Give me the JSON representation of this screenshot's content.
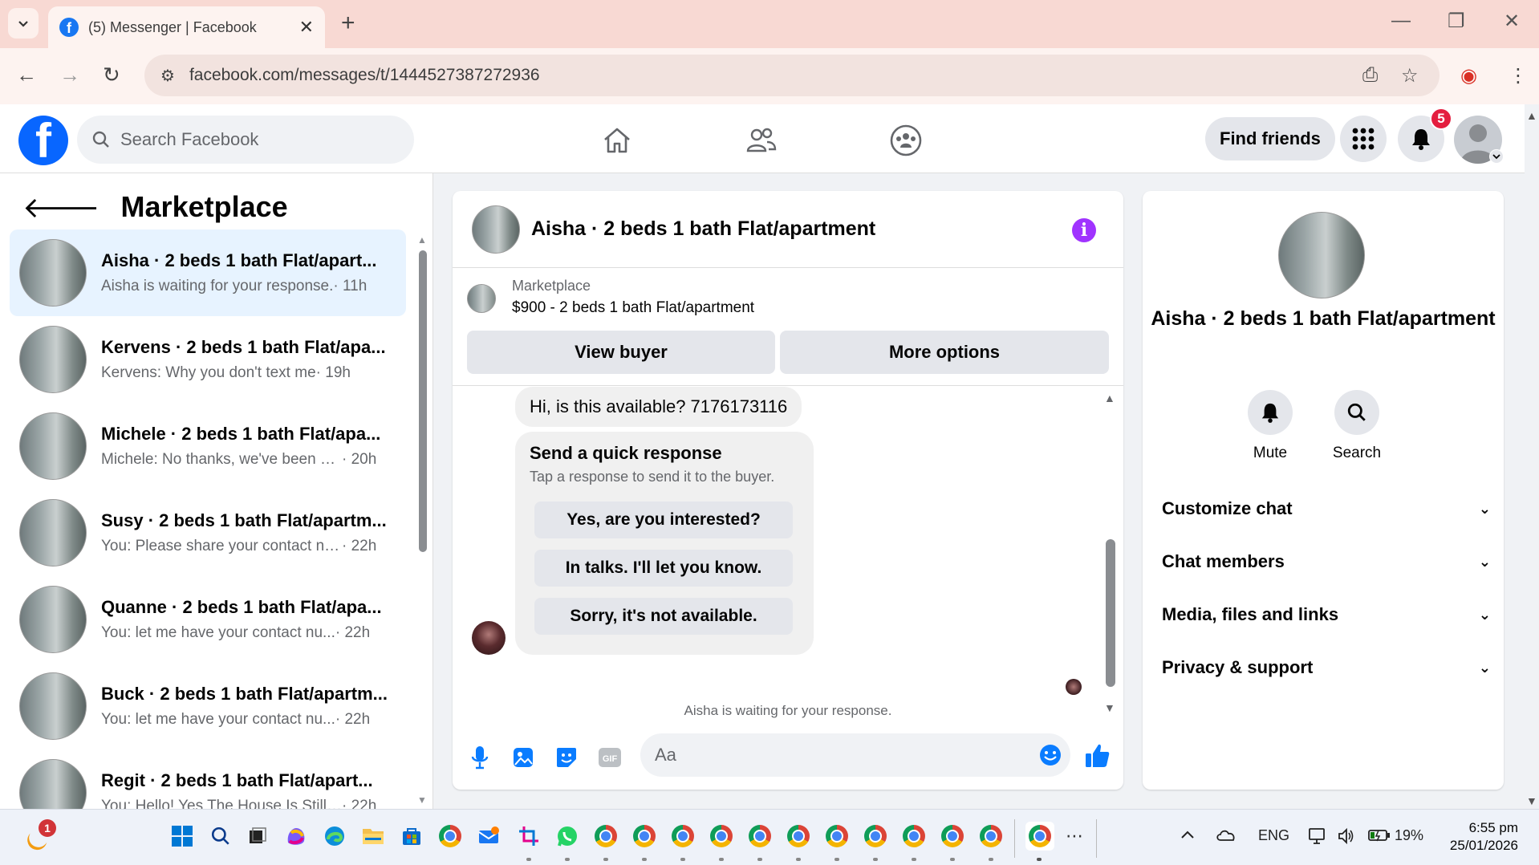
{
  "browser": {
    "tab_title": "(5) Messenger | Facebook",
    "url": "facebook.com/messages/t/1444527387272936"
  },
  "fb": {
    "search_placeholder": "Search Facebook",
    "find_friends": "Find friends",
    "notification_count": "5"
  },
  "left": {
    "title": "Marketplace",
    "conversations": [
      {
        "name": "Aisha · 2 beds 1 bath Flat/apart...",
        "preview": "Aisha is waiting for your response.",
        "time": "· 11h",
        "active": true
      },
      {
        "name": "Kervens · 2 beds 1 bath Flat/apa...",
        "preview": "Kervens: Why you don't text me",
        "time": "· 19h"
      },
      {
        "name": "Michele · 2 beds 1 bath Flat/apa...",
        "preview": "Michele: No thanks, we've been al...",
        "time": "· 20h"
      },
      {
        "name": "Susy · 2 beds 1 bath Flat/apartm...",
        "preview": "You: Please share your contact nu...",
        "time": "· 22h"
      },
      {
        "name": "Quanne · 2 beds 1 bath Flat/apa...",
        "preview": "You: let me have your contact nu...",
        "time": "· 22h"
      },
      {
        "name": "Buck · 2 beds 1 bath Flat/apartm...",
        "preview": "You: let me have your contact nu...",
        "time": "· 22h"
      },
      {
        "name": "Regit · 2 beds 1 bath Flat/apart...",
        "preview": "You: Hello! Yes The House Is Still A...",
        "time": "· 22h"
      }
    ]
  },
  "chat": {
    "title": "Aisha · 2 beds 1 bath Flat/apartment",
    "marketplace_label": "Marketplace",
    "listing": "$900 - 2 beds 1 bath Flat/apartment",
    "view_buyer": "View buyer",
    "more_options": "More options",
    "message": "Hi, is this available? 7176173116",
    "quick_title": "Send a quick response",
    "quick_sub": "Tap a response to send it to the buyer.",
    "quick_responses": [
      "Yes, are you interested?",
      "In talks. I'll let you know.",
      "Sorry, it's not available."
    ],
    "waiting": "Aisha is waiting for your response.",
    "composer_placeholder": "Aa",
    "gif_label": "GIF"
  },
  "right": {
    "name": "Aisha · 2 beds 1 bath Flat/apartment",
    "mute": "Mute",
    "search": "Search",
    "sections": [
      "Customize chat",
      "Chat members",
      "Media, files and links",
      "Privacy & support"
    ]
  },
  "taskbar": {
    "start_badge": "1",
    "lang": "ENG",
    "battery": "19%",
    "time": "6:55 pm",
    "date": "25/01/2026"
  },
  "colors": {
    "fb_blue": "#0866ff",
    "active_bg": "#e7f3ff",
    "info_purple": "#a033ff",
    "composer_blue": "#0a7cff"
  }
}
